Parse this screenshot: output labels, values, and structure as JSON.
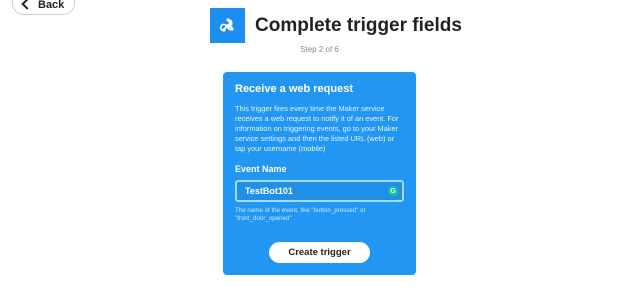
{
  "nav": {
    "back_label": "Back"
  },
  "header": {
    "title": "Complete trigger fields",
    "step": "Step 2 of 6"
  },
  "card": {
    "title": "Receive a web request",
    "description": "This trigger fires every time the Maker service receives a web request to notify it of an event. For information on triggering events, go to your Maker service settings and then the listed URL (web) or tap your username (mobile)",
    "field_label": "Event Name",
    "field_value": "TestBot101",
    "help_text": "The name of the event, like \"button_pressed\" or \"front_door_opened\"",
    "submit_label": "Create trigger"
  },
  "colors": {
    "accent": "#2196f3",
    "icon_bg": "#1b8ef0"
  },
  "icons": {
    "service": "webhooks-icon",
    "back": "chevron-left-icon",
    "extension": "grammarly-icon"
  }
}
